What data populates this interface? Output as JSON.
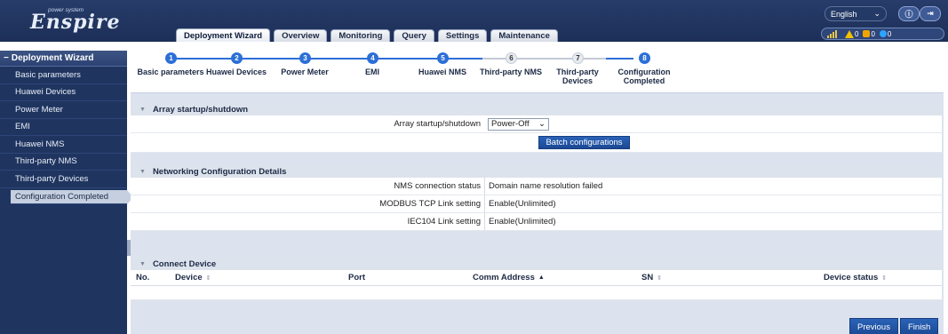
{
  "header": {
    "logo_text": "Enspire",
    "logo_sub": "power system",
    "language": "English",
    "tabs": [
      {
        "label": "Deployment Wizard",
        "active": true
      },
      {
        "label": "Overview"
      },
      {
        "label": "Monitoring"
      },
      {
        "label": "Query"
      },
      {
        "label": "Settings"
      },
      {
        "label": "Maintenance"
      }
    ],
    "info_icon": "info-icon",
    "logout_icon": "logout-icon",
    "alarms": {
      "critical": "0",
      "major": "0",
      "minor": "0"
    },
    "colors": {
      "header_bg": "#1d2f58",
      "accent": "#2c6fd6"
    }
  },
  "sidebar": {
    "title": "Deployment Wizard",
    "items": [
      {
        "label": "Basic parameters"
      },
      {
        "label": "Huawei Devices"
      },
      {
        "label": "Power Meter"
      },
      {
        "label": "EMI"
      },
      {
        "label": "Huawei NMS"
      },
      {
        "label": "Third-party NMS"
      },
      {
        "label": "Third-party Devices"
      },
      {
        "label": "Configuration Completed",
        "active": true
      }
    ]
  },
  "wizard": {
    "steps": [
      {
        "num": "1",
        "label": "Basic parameters",
        "done": true
      },
      {
        "num": "2",
        "label": "Huawei Devices",
        "done": true
      },
      {
        "num": "3",
        "label": "Power Meter",
        "done": true
      },
      {
        "num": "4",
        "label": "EMI",
        "done": true
      },
      {
        "num": "5",
        "label": "Huawei NMS",
        "done": true
      },
      {
        "num": "6",
        "label": "Third-party NMS",
        "done": false
      },
      {
        "num": "7",
        "label": "Third-party Devices",
        "done": false
      },
      {
        "num": "8",
        "label": "Configuration Completed",
        "done": true
      }
    ]
  },
  "array_section": {
    "title": "Array startup/shutdown",
    "field_label": "Array startup/shutdown",
    "field_value": "Power-Off",
    "button": "Batch configurations"
  },
  "network_section": {
    "title": "Networking Configuration Details",
    "rows": [
      {
        "label": "NMS connection status",
        "value": "Domain name resolution failed"
      },
      {
        "label": "MODBUS TCP Link setting",
        "value": "Enable(Unlimited)"
      },
      {
        "label": "IEC104 Link setting",
        "value": "Enable(Unlimited)"
      }
    ]
  },
  "device_section": {
    "title": "Connect Device",
    "columns": [
      "No.",
      "Device",
      "Port",
      "Comm Address",
      "SN",
      "Device status"
    ]
  },
  "footer": {
    "previous": "Previous",
    "finish": "Finish"
  }
}
